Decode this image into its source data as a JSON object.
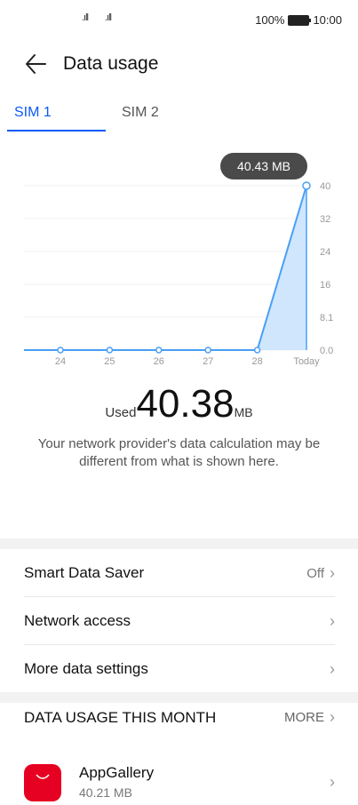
{
  "status_bar": {
    "battery": "100%",
    "time": "10:00"
  },
  "header": {
    "title": "Data usage"
  },
  "tabs": [
    {
      "label": "SIM 1",
      "active": true
    },
    {
      "label": "SIM 2",
      "active": false
    }
  ],
  "chart_data": {
    "type": "area",
    "categories": [
      "24",
      "25",
      "26",
      "27",
      "28",
      "Today"
    ],
    "values": [
      0,
      0,
      0,
      0,
      0,
      40.43
    ],
    "y_ticks": [
      "40",
      "32",
      "24",
      "16",
      "8.1",
      "0.0"
    ],
    "ylim": [
      0,
      40.43
    ],
    "tooltip": "40.43 MB",
    "color": "#4a9ff5"
  },
  "usage": {
    "used_label": "Used",
    "value": "40.38",
    "unit": "MB"
  },
  "disclaimer": "Your network provider's data calculation may be different from what is shown here.",
  "settings": [
    {
      "label": "Smart Data Saver",
      "value": "Off"
    },
    {
      "label": "Network access",
      "value": ""
    },
    {
      "label": "More data settings",
      "value": ""
    }
  ],
  "section": {
    "title": "DATA USAGE THIS MONTH",
    "more": "MORE"
  },
  "apps": [
    {
      "name": "AppGallery",
      "size": "40.21 MB",
      "icon_label": "HUAWEI"
    }
  ]
}
